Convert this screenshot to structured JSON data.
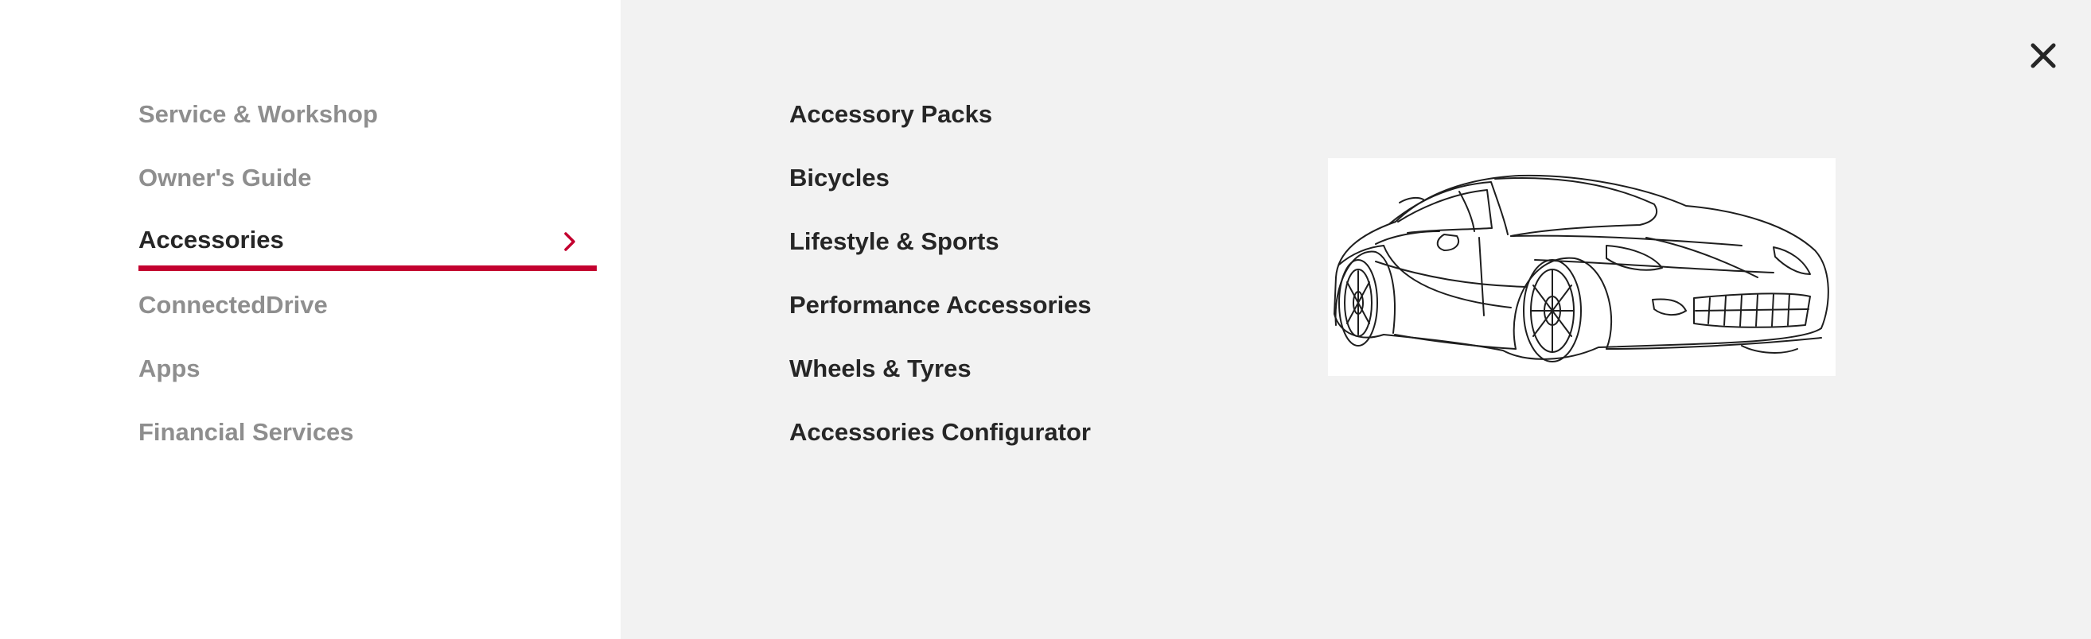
{
  "primary_nav": {
    "items": [
      {
        "label": "Service & Workshop"
      },
      {
        "label": "Owner's Guide"
      },
      {
        "label": "Accessories"
      },
      {
        "label": "ConnectedDrive"
      },
      {
        "label": "Apps"
      },
      {
        "label": "Financial Services"
      }
    ],
    "active_index": 2
  },
  "secondary_nav": {
    "items": [
      {
        "label": "Accessory Packs"
      },
      {
        "label": "Bicycles"
      },
      {
        "label": "Lifestyle & Sports"
      },
      {
        "label": "Performance Accessories"
      },
      {
        "label": "Wheels & Tyres"
      },
      {
        "label": "Accessories Configurator"
      }
    ]
  },
  "icons": {
    "close": "close-icon",
    "chevron": "chevron-right-icon",
    "promo": "sports-car-sketch"
  },
  "colors": {
    "accent": "#c3002f",
    "active_text": "#262626",
    "inactive_text": "#8e8e8e",
    "right_panel_bg": "#f2f2f2"
  }
}
